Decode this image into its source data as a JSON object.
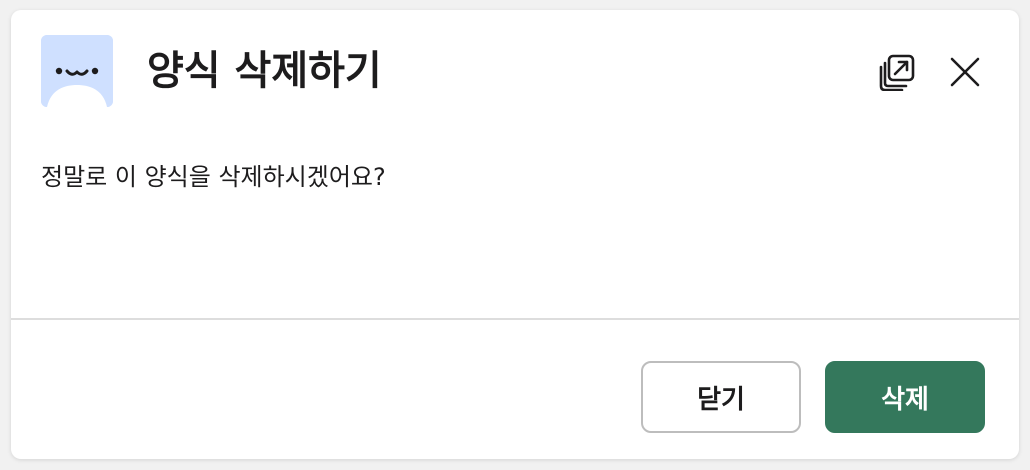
{
  "dialog": {
    "title": "양식 삭제하기",
    "message": "정말로 이 양식을 삭제하시겠어요?",
    "icons": {
      "avatar": "blob-face-avatar",
      "popout": "popout-icon",
      "close": "close-icon"
    },
    "buttons": {
      "close_label": "닫기",
      "delete_label": "삭제"
    },
    "colors": {
      "primary": "#34785c",
      "avatar_bg": "#cfe0ff",
      "text": "#1d1c1d"
    }
  }
}
